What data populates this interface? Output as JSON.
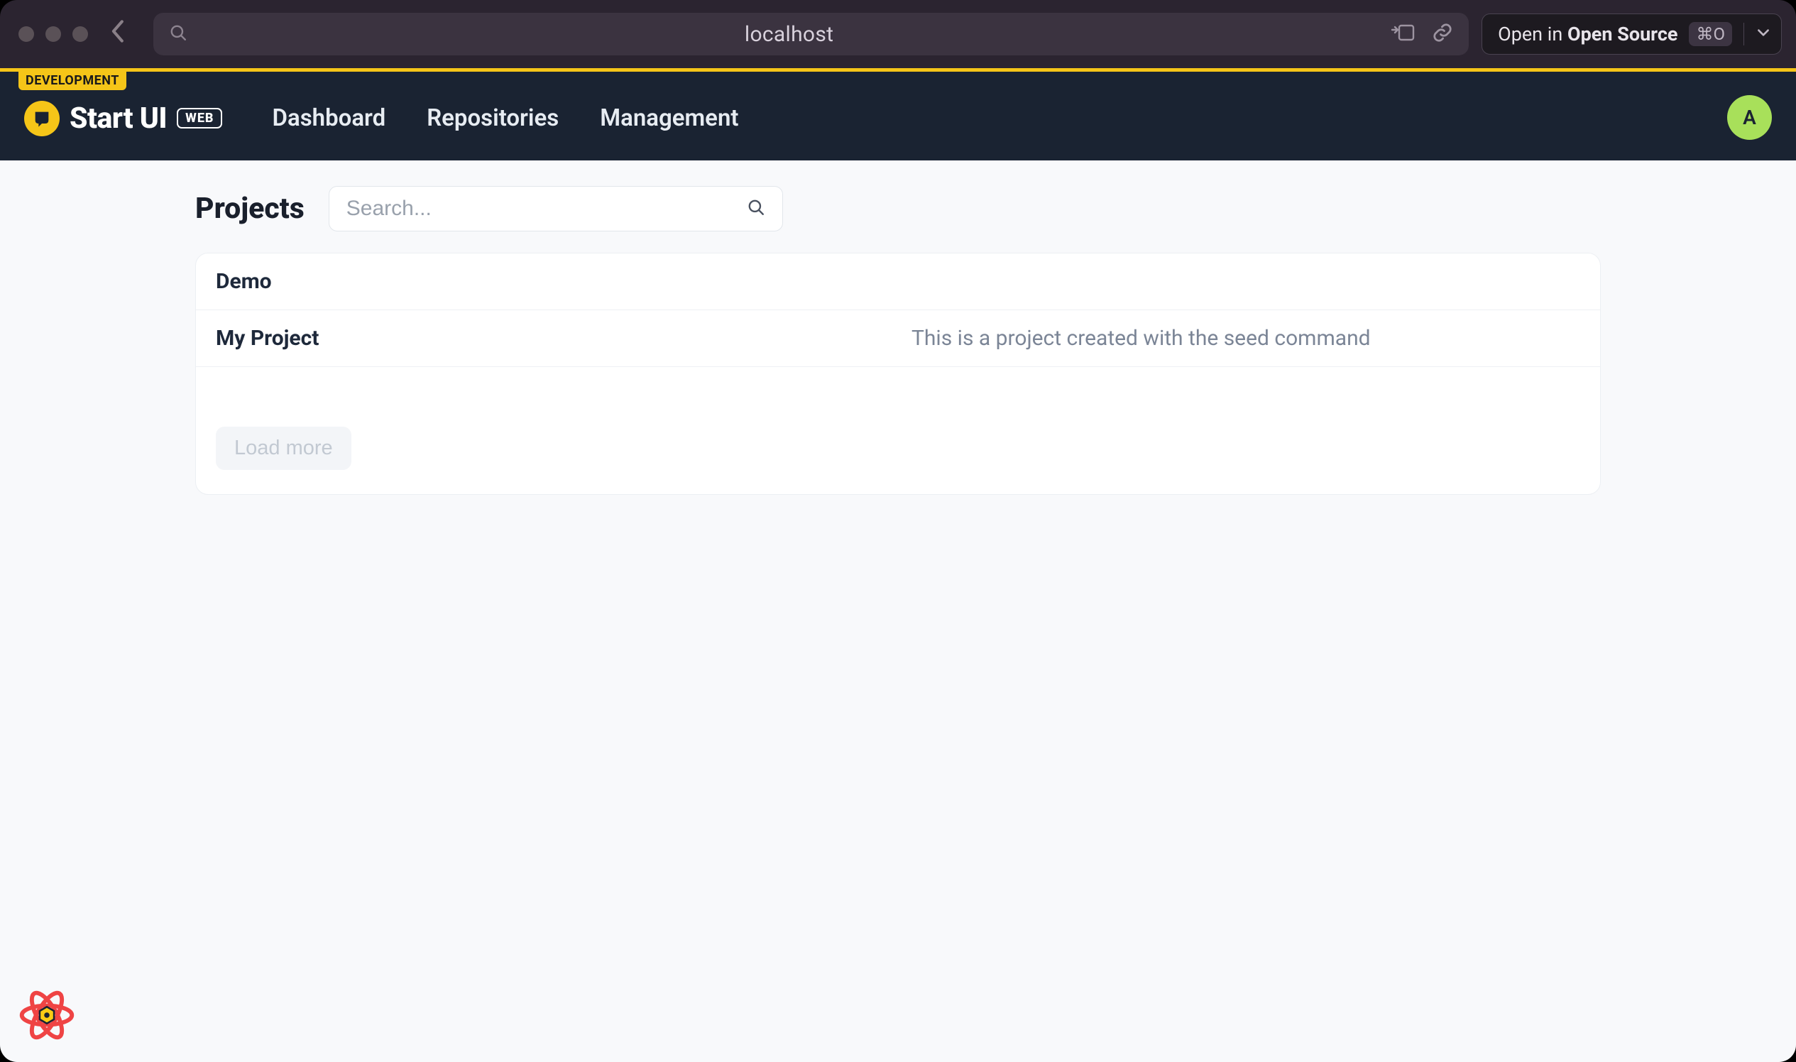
{
  "browser": {
    "address": "localhost",
    "open_in_prefix": "Open in ",
    "open_in_target": "Open Source",
    "shortcut": "⌘O"
  },
  "header": {
    "dev_badge": "DEVELOPMENT",
    "brand": "Start UI",
    "brand_tag": "WEB",
    "nav": [
      {
        "label": "Dashboard"
      },
      {
        "label": "Repositories"
      },
      {
        "label": "Management"
      }
    ],
    "avatar_initial": "A"
  },
  "page": {
    "title": "Projects",
    "search_placeholder": "Search...",
    "projects": [
      {
        "name": "Demo",
        "description": ""
      },
      {
        "name": "My Project",
        "description": "This is a project created with the seed command"
      }
    ],
    "load_more_label": "Load more"
  }
}
